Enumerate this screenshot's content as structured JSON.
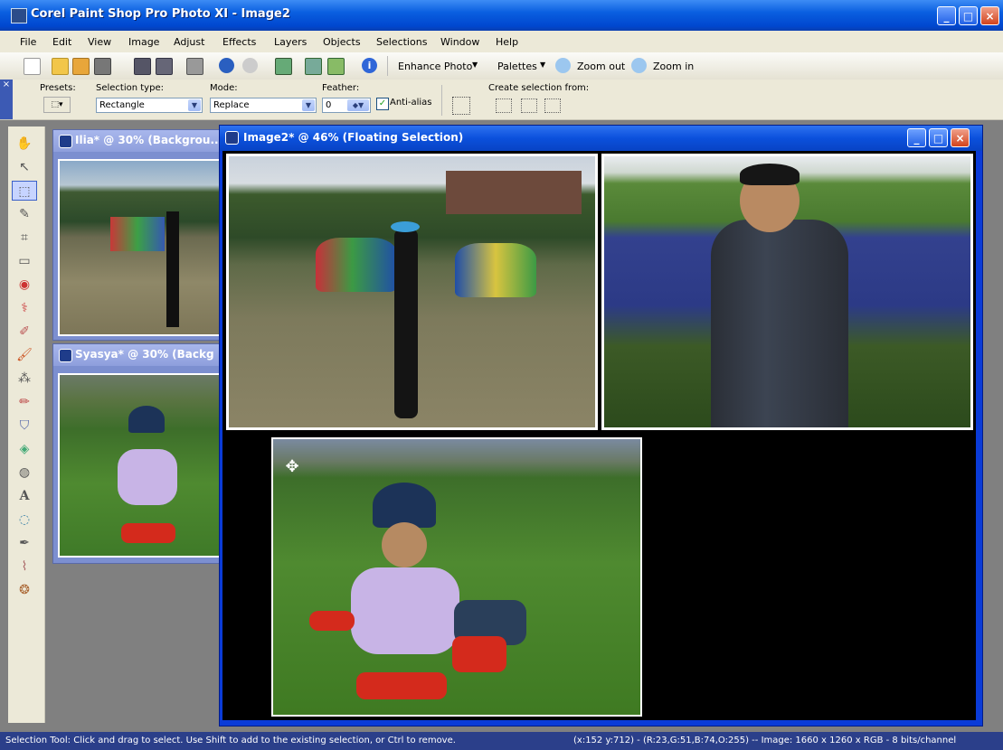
{
  "window": {
    "title": "Corel Paint Shop Pro Photo XI - Image2"
  },
  "menu": [
    "File",
    "Edit",
    "View",
    "Image",
    "Adjust",
    "Effects",
    "Layers",
    "Objects",
    "Selections",
    "Window",
    "Help"
  ],
  "toolbar": {
    "enhance_photo": "Enhance Photo",
    "palettes": "Palettes",
    "zoom_out": "Zoom out",
    "zoom_in": "Zoom in"
  },
  "tool_options": {
    "presets_label": "Presets:",
    "selection_type_label": "Selection type:",
    "selection_type_value": "Rectangle",
    "mode_label": "Mode:",
    "mode_value": "Replace",
    "feather_label": "Feather:",
    "feather_value": "0",
    "antialias_label": "Anti-alias",
    "antialias_checked": true,
    "create_selection_label": "Create selection from:"
  },
  "side_windows": [
    {
      "title": "Ilia* @  30% (Backgrou..."
    },
    {
      "title": "Syasya* @  30% (Backg"
    }
  ],
  "main_window": {
    "title": "Image2* @  46% (Floating Selection)"
  },
  "status": {
    "hint": "Selection Tool: Click and drag to select. Use Shift to add to the existing selection, or Ctrl to remove.",
    "info": "(x:152 y:712) - (R:23,G:51,B:74,O:255) -- Image:  1660 x 1260 x RGB - 8 bits/channel"
  },
  "colors": {
    "title_blue": "#0047cf",
    "status_bar": "#2b3f8a",
    "canvas_bg": "#000000",
    "workspace": "#808080"
  },
  "icons": [
    "new-icon",
    "open-icon",
    "browse-icon",
    "save-icon",
    "save-as-icon",
    "print-icon",
    "undo-icon",
    "redo-icon",
    "crop-icon",
    "info-icon",
    "pan-icon",
    "pick-icon",
    "selection-icon",
    "eyedropper-icon",
    "crop-tool-icon",
    "straighten-icon",
    "red-eye-icon",
    "clone-icon",
    "paint-brush-icon",
    "eraser-icon",
    "fill-icon",
    "text-icon",
    "pen-icon"
  ]
}
